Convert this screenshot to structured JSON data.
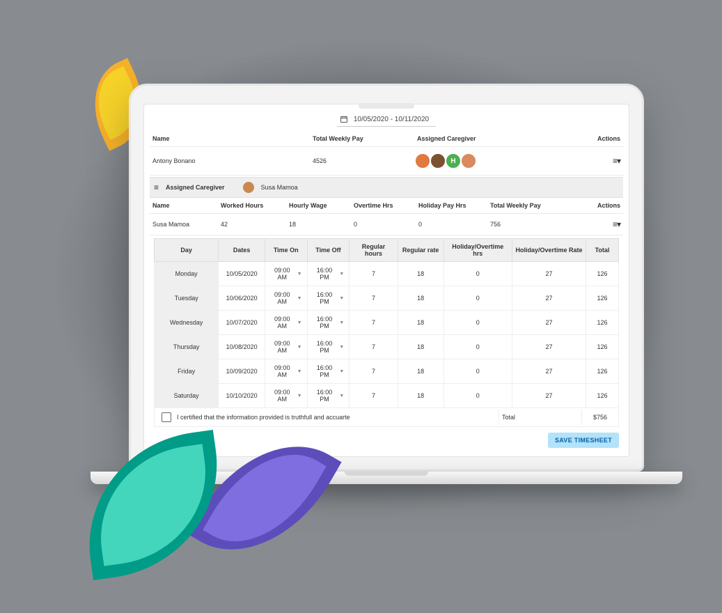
{
  "date_range": "10/05/2020 - 10/11/2020",
  "client_header": {
    "name": "Name",
    "pay": "Total Weekly Pay",
    "assigned": "Assigned Caregiver",
    "actions": "Actions"
  },
  "client": {
    "name": "Antony Bonano",
    "pay": "4526",
    "avatars": [
      "",
      "",
      "H",
      ""
    ]
  },
  "caregiver_bar": {
    "label": "Assigned Caregiver",
    "name": "Susa Mamoa"
  },
  "sub_header": {
    "name": "Name",
    "worked": "Worked Hours",
    "wage": "Hourly Wage",
    "overtime": "Overtime Hrs",
    "holiday": "Holiday Pay Hrs",
    "total": "Total Weekly Pay",
    "actions": "Actions"
  },
  "caregiver_row": {
    "name": "Susa Mamoa",
    "worked": "42",
    "wage": "18",
    "overtime": "0",
    "holiday": "0",
    "total": "756"
  },
  "detail_header": {
    "day": "Day",
    "dates": "Dates",
    "time_on": "Time On",
    "time_off": "Time Off",
    "regular_hours": "Regular hours",
    "regular_rate": "Regular rate",
    "holiday_hrs": "Holiday/Overtime hrs",
    "holiday_rate": "Holiday/Overtime Rate",
    "total": "Total"
  },
  "detail_rows": [
    {
      "day": "Monday",
      "date": "10/05/2020",
      "on": "09:00 AM",
      "off": "16:00 PM",
      "reg_h": "7",
      "reg_r": "18",
      "hol_h": "0",
      "hol_r": "27",
      "total": "126"
    },
    {
      "day": "Tuesday",
      "date": "10/06/2020",
      "on": "09:00 AM",
      "off": "16:00 PM",
      "reg_h": "7",
      "reg_r": "18",
      "hol_h": "0",
      "hol_r": "27",
      "total": "126"
    },
    {
      "day": "Wednesday",
      "date": "10/07/2020",
      "on": "09:00 AM",
      "off": "16:00 PM",
      "reg_h": "7",
      "reg_r": "18",
      "hol_h": "0",
      "hol_r": "27",
      "total": "126"
    },
    {
      "day": "Thursday",
      "date": "10/08/2020",
      "on": "09:00 AM",
      "off": "16:00 PM",
      "reg_h": "7",
      "reg_r": "18",
      "hol_h": "0",
      "hol_r": "27",
      "total": "126"
    },
    {
      "day": "Friday",
      "date": "10/09/2020",
      "on": "09:00 AM",
      "off": "16:00 PM",
      "reg_h": "7",
      "reg_r": "18",
      "hol_h": "0",
      "hol_r": "27",
      "total": "126"
    },
    {
      "day": "Saturday",
      "date": "10/10/2020",
      "on": "09:00 AM",
      "off": "16:00 PM",
      "reg_h": "7",
      "reg_r": "18",
      "hol_h": "0",
      "hol_r": "27",
      "total": "126"
    }
  ],
  "certify_text": "I certified that the information provided is truthfull and accuarte",
  "grand_total_label": "Total",
  "grand_total_value": "$756",
  "save_button": "SAVE TIMESHEET"
}
